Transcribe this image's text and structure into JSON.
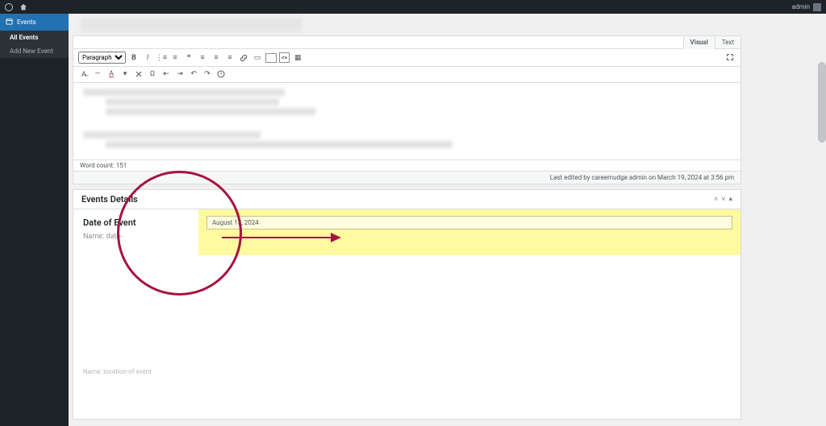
{
  "topbar": {
    "user": "admin"
  },
  "sidebar": {
    "main": "Events",
    "sub1": "All Events",
    "sub2": "Add New Event"
  },
  "editor": {
    "tab_visual": "Visual",
    "tab_text": "Text",
    "format_select": "Paragraph",
    "word_count": "Word count: 151",
    "last_edited": "Last edited by careernudge admin on March 19, 2024 at 3:56 pm"
  },
  "metabox": {
    "title": "Events Details",
    "field_label": "Date of Event",
    "field_hint": "Name: date-",
    "field_value": "August 13, 2024",
    "loc_hint": "Name: location-of-event"
  }
}
